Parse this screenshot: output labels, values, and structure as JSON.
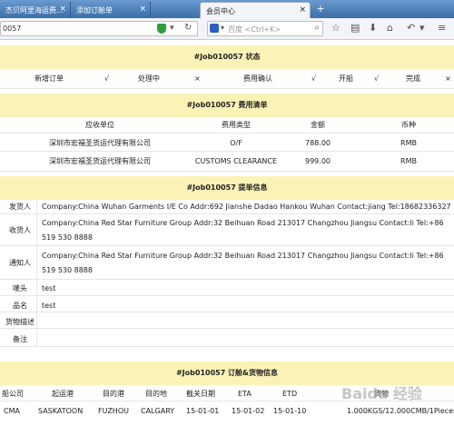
{
  "browser": {
    "tabs": [
      {
        "title": "杰贝阿里海运费...",
        "active": false
      },
      {
        "title": "添加订舱单",
        "active": false
      },
      {
        "title": "会员中心",
        "active": true
      }
    ],
    "url": "0057",
    "search_placeholder": "百度 <Ctrl+K>"
  },
  "status_section": {
    "title": "#Job010057 状态",
    "items": [
      {
        "label": "新增订单",
        "mark": "√"
      },
      {
        "label": "处理中",
        "mark": "×"
      },
      {
        "label": "费用确认",
        "mark": "√"
      },
      {
        "label": "开船",
        "mark": "√"
      },
      {
        "label": "完成",
        "mark": "×"
      }
    ]
  },
  "fee_section": {
    "title": "#Job010057 费用清单",
    "headers": [
      "应收单位",
      "费用类型",
      "金额",
      "币种"
    ],
    "rows": [
      [
        "深圳市宏福圣货运代理有限公司",
        "O/F",
        "788.00",
        "RMB"
      ],
      [
        "深圳市宏福圣货运代理有限公司",
        "CUSTOMS CLEARANCE",
        "999.00",
        "RMB"
      ]
    ]
  },
  "bl_section": {
    "title": "#Job010057 提单信息",
    "fields": [
      {
        "label": "发货人",
        "value": "Company:China Wuhan Garments I/E Co   Addr:692 Jianshe Dadao Hankou Wuhan   Contact:jiang   Tel:18682336327"
      },
      {
        "label": "收货人",
        "value": "Company:China Red Star Furniture Group   Addr:32 Beihuan Road 213017 Changzhou Jiangsu   Contact:li   Tel:+86 519 530 8888"
      },
      {
        "label": "通知人",
        "value": "Company:China Red Star Furniture Group   Addr:32 Beihuan Road 213017 Changzhou Jiangsu   Contact:li   Tel:+86 519 530 8888"
      },
      {
        "label": "唛头",
        "value": "test"
      },
      {
        "label": "品名",
        "value": "test"
      },
      {
        "label": "货物描述",
        "value": ""
      },
      {
        "label": "备注",
        "value": ""
      }
    ]
  },
  "order_section": {
    "title": "#Job010057 订舱&货物信息",
    "headers": [
      "船公司",
      "起运港",
      "目的港",
      "目的地",
      "截关日期",
      "ETA",
      "ETD",
      "货物"
    ],
    "row": [
      "CMA",
      "SASKATOON",
      "FUZHOU",
      "CALGARY",
      "15-01-01",
      "15-01-02",
      "15-01-10",
      "1.000KGS/12.000CMB/1Pieces"
    ]
  },
  "watermark": "Baidu 经验"
}
